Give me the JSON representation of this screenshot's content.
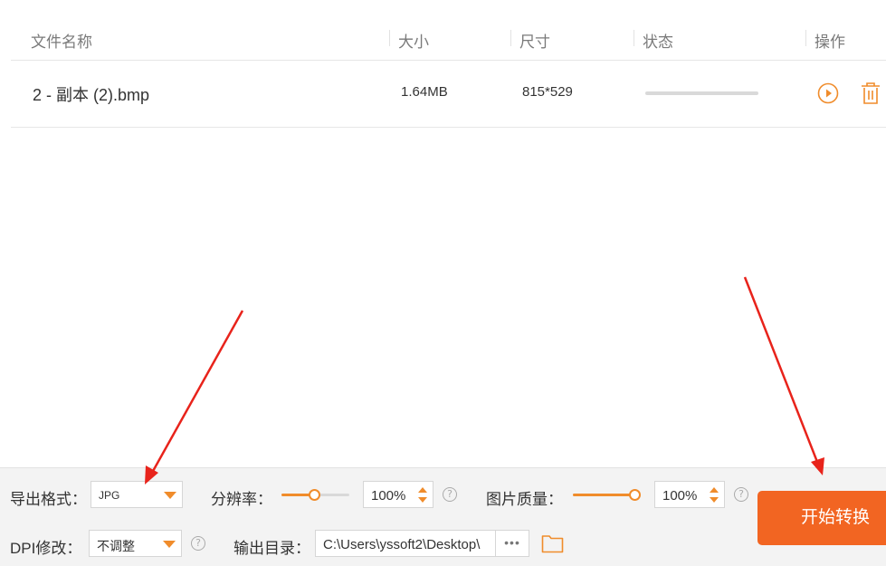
{
  "table": {
    "headers": {
      "name": "文件名称",
      "size": "大小",
      "dimensions": "尺寸",
      "status": "状态",
      "actions": "操作"
    },
    "rows": [
      {
        "name": "2 - 副本 (2).bmp",
        "size": "1.64MB",
        "dimensions": "815*529",
        "progress": 0,
        "actions": [
          "play-icon",
          "trash-icon"
        ]
      }
    ]
  },
  "settings": {
    "export_format_label": "导出格式：",
    "export_format_value": "JPG",
    "resolution_label": "分辨率：",
    "resolution_value": "100",
    "resolution_unit": "%",
    "quality_label": "图片质量：",
    "quality_value": "100",
    "quality_unit": "%",
    "dpi_label": "DPI修改：",
    "dpi_value": "不调整",
    "output_dir_label": "输出目录：",
    "output_dir_value": "C:\\Users\\yssoft2\\Desktop\\",
    "browse_label": "•••",
    "help_glyph": "?"
  },
  "start_button": {
    "label": "开始转换"
  },
  "colors": {
    "accent": "#f08c2b",
    "start_button": "#f26522",
    "annotation_arrow": "#e8231b"
  }
}
